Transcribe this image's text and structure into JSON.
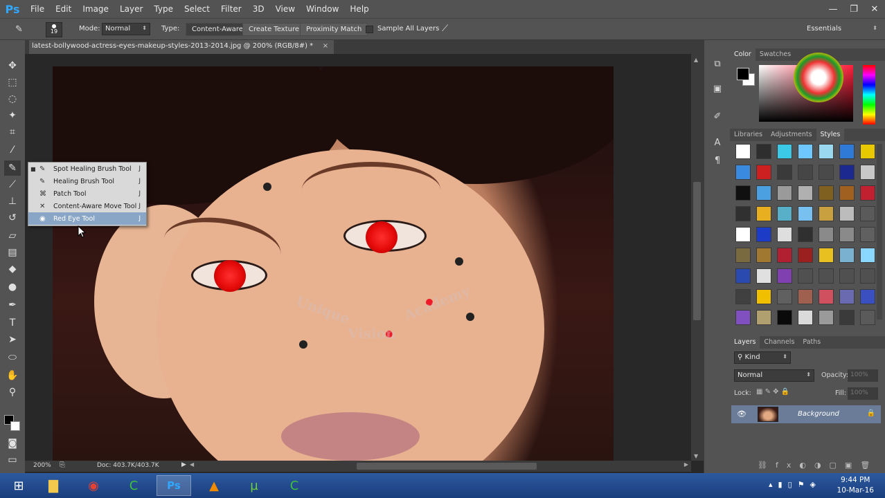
{
  "app": {
    "logo": "Ps"
  },
  "menu": [
    "File",
    "Edit",
    "Image",
    "Layer",
    "Type",
    "Select",
    "Filter",
    "3D",
    "View",
    "Window",
    "Help"
  ],
  "window_controls": {
    "minimize": "—",
    "restore": "❐",
    "close": "✕"
  },
  "options": {
    "brush_size": "19",
    "mode_label": "Mode:",
    "mode_value": "Normal",
    "type_label": "Type:",
    "type_buttons": [
      "Content-Aware",
      "Create Texture",
      "Proximity Match"
    ],
    "sample_all_layers": "Sample All Layers",
    "workspace": "Essentials"
  },
  "document": {
    "tab_title": "latest-bollywood-actress-eyes-makeup-styles-2013-2014.jpg @ 200% (RGB/8#) *",
    "close": "×"
  },
  "status": {
    "zoom": "200%",
    "doc": "Doc: 403.7K/403.7K"
  },
  "flyout": {
    "items": [
      {
        "label": "Spot Healing Brush Tool",
        "shortcut": "J",
        "icon": "spot-healing-brush-icon",
        "selected": true
      },
      {
        "label": "Healing Brush Tool",
        "shortcut": "J",
        "icon": "healing-brush-icon"
      },
      {
        "label": "Patch Tool",
        "shortcut": "J",
        "icon": "patch-icon"
      },
      {
        "label": "Content-Aware Move Tool",
        "shortcut": "J",
        "icon": "content-aware-move-icon"
      },
      {
        "label": "Red Eye Tool",
        "shortcut": "J",
        "icon": "red-eye-icon",
        "highlighted": true
      }
    ]
  },
  "watermark": {
    "line1": "Unique",
    "line2": "Vision",
    "line3": "Academy"
  },
  "color_panel": {
    "tabs": [
      "Color",
      "Swatches"
    ],
    "active": "Color"
  },
  "styles_panel": {
    "tabs": [
      "Libraries",
      "Adjustments",
      "Styles"
    ],
    "active": "Styles",
    "swatch_colors": [
      "#ffffff",
      "#2e2e2e",
      "#3cc9e8",
      "#6ec8ff",
      "#9ad8f0",
      "#2f7ad6",
      "#e8c900",
      "#3a8ae0",
      "#cc2020",
      "#3a3a3a",
      "#464646",
      "#4a4a4a",
      "#1c2a90",
      "#c8c8c8",
      "#101010",
      "#4aa0e0",
      "#9a9a9a",
      "#b0b0b0",
      "#806020",
      "#a06020",
      "#c02030",
      "#303030",
      "#e8b020",
      "#58b0c8",
      "#78c0f0",
      "#c8a040",
      "#bcbcbc",
      "#5a5a5a",
      "#ffffff",
      "#1c3cc8",
      "#dedede",
      "#303030",
      "#8a8a8a",
      "#8a8a8a",
      "#606060",
      "#7a6a40",
      "#a07830",
      "#b02030",
      "#9a2020",
      "#e8c020",
      "#7ab0d0",
      "#8ad8ff",
      "#2a4ab0",
      "#e0e0e0",
      "#8040b0",
      "#505050",
      "#505050",
      "#505050",
      "#505050",
      "#404040",
      "#f0c000",
      "#606060",
      "#a06050",
      "#d05060",
      "#6a6ab0",
      "#3a50c0",
      "#8050c0",
      "#b0a070",
      "#0a0a0a",
      "#dadada",
      "#9a9a9a",
      "#3a3a3a",
      "#5a5a5a"
    ]
  },
  "layers_panel": {
    "tabs": [
      "Layers",
      "Channels",
      "Paths"
    ],
    "active": "Layers",
    "filter_kind": "Kind",
    "blend_mode": "Normal",
    "opacity_label": "Opacity:",
    "opacity_value": "100%",
    "lock_label": "Lock:",
    "fill_label": "Fill:",
    "fill_value": "100%",
    "layers": [
      {
        "name": "Background",
        "visible": true,
        "locked": true
      }
    ]
  },
  "taskbar": {
    "apps": [
      "start-icon",
      "file-explorer-icon",
      "chrome-icon",
      "camtasia-icon",
      "photoshop-icon",
      "vlc-icon",
      "utorrent-icon",
      "camtasia-recorder-icon"
    ],
    "time": "9:44 PM",
    "date": "10-Mar-16"
  }
}
